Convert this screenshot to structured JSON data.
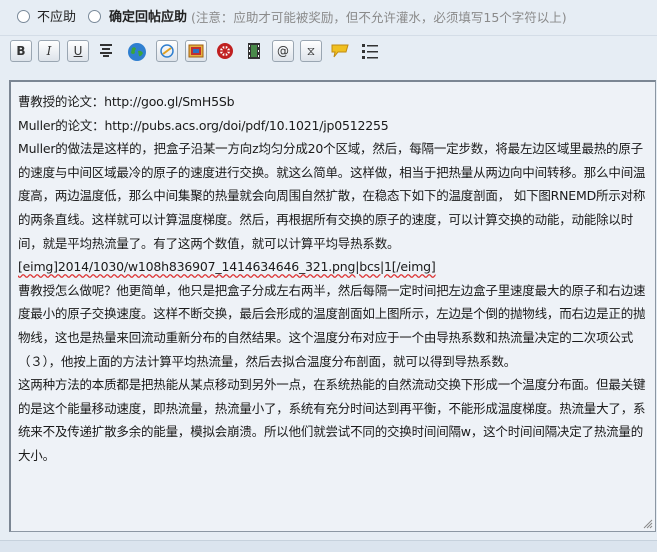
{
  "reply_options": {
    "option_none": "不应助",
    "option_confirm": "确定回帖应助",
    "note": "(注意：应助才可能被奖励，但不允许灌水，必须填写15个字符以上)"
  },
  "toolbar": {
    "buttons": [
      {
        "icon": "bold-icon",
        "glyph": "B"
      },
      {
        "icon": "italic-icon",
        "glyph": "I"
      },
      {
        "icon": "underline-icon",
        "glyph": "U"
      },
      {
        "icon": "align-center-icon",
        "glyph": "≡"
      },
      {
        "icon": "globe-icon",
        "glyph": ""
      },
      {
        "icon": "link-icon",
        "glyph": ""
      },
      {
        "icon": "image-icon",
        "glyph": ""
      },
      {
        "icon": "flash-icon",
        "glyph": ""
      },
      {
        "icon": "film-icon",
        "glyph": ""
      },
      {
        "icon": "at-icon",
        "glyph": "@"
      },
      {
        "icon": "hourglass-icon",
        "glyph": "⧖"
      },
      {
        "icon": "quote-icon",
        "glyph": ""
      },
      {
        "icon": "list-icon",
        "glyph": ""
      }
    ]
  },
  "editor": {
    "lines": [
      "曹教授的论文：http://goo.gl/SmH5Sb",
      "Muller的论文：http://pubs.acs.org/doi/pdf/10.1021/jp0512255",
      "Muller的做法是这样的，把盒子沿某一方向z均匀分成20个区域，然后，每隔一定步数，将最左边区域里最热的原子的速度与中间区域最冷的原子的速度进行交换。就这么简单。这样做，相当于把热量从两边向中间转移。那么中间温度高，两边温度低，那么中间集聚的热量就会向周围自然扩散，在稳态下如下的温度剖面， 如下图RNEMD所示对称的两条直线。这样就可以计算温度梯度。然后，再根据所有交换的原子的速度，可以计算交换的动能，动能除以时间，就是平均热流量了。有了这两个数值，就可以计算平均导热系数。",
      "[eimg]2014/1030/w108h836907_1414634646_321.png|bcs|1[/eimg]",
      "曹教授怎么做呢？他更简单，他只是把盒子分成左右两半，然后每隔一定时间把左边盒子里速度最大的原子和右边速度最小的原子交换速度。这样不断交换，最后会形成的温度剖面如上图所示，左边是个倒的抛物线，而右边是正的抛物线，这也是热量来回流动重新分布的自然结果。这个温度分布对应于一个由导热系数和热流量决定的二次项公式（３），他按上面的方法计算平均热流量，然后去拟合温度分布剖面，就可以得到导热系数。",
      "这两种方法的本质都是把热能从某点移动到另外一点，在系统热能的自然流动交换下形成一个温度分布面。但最关键的是这个能量移动速度，即热流量，热流量小了，系统有充分时间达到再平衡，不能形成温度梯度。热流量大了，系统来不及传递扩散多余的能量，模拟会崩溃。所以他们就尝试不同的交换时间间隔w，这个时间间隔决定了热流量的大小。"
    ]
  }
}
